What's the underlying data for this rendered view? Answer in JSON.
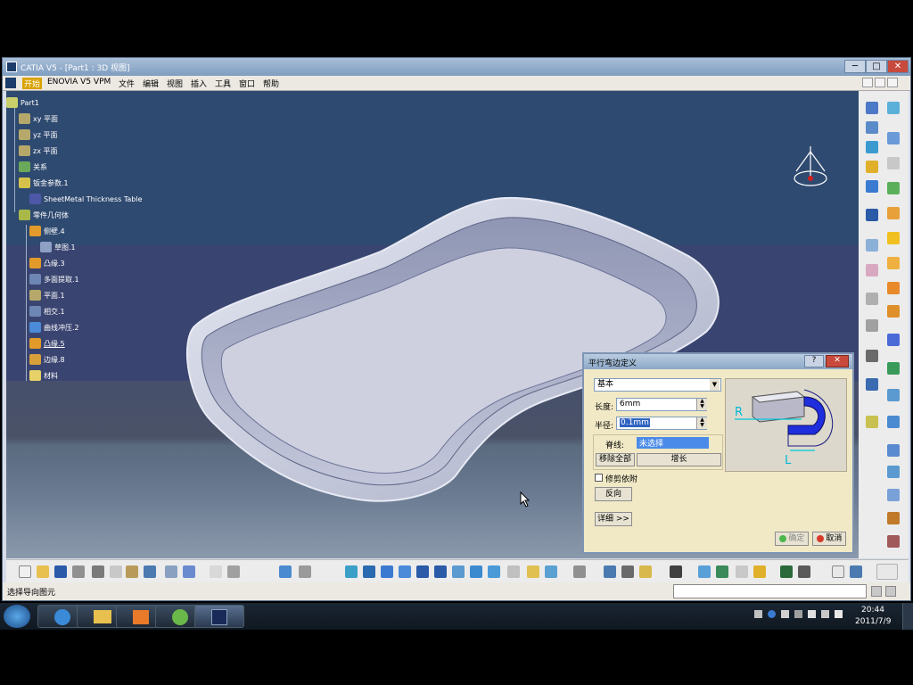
{
  "window": {
    "title": "CATIA V5 - [Part1 : 3D 视图]",
    "min_label": "─",
    "max_label": "□",
    "close_label": "✕"
  },
  "menu": [
    "开始",
    "ENOVIA V5 VPM",
    "文件",
    "编辑",
    "视图",
    "插入",
    "工具",
    "窗口",
    "帮助"
  ],
  "tree": {
    "root": "Part1",
    "nodes": [
      {
        "label": "xy 平面"
      },
      {
        "label": "yz 平面"
      },
      {
        "label": "zx 平面"
      },
      {
        "label": "关系"
      },
      {
        "label": "钣金参数.1"
      },
      {
        "label": "SheetMetal Thickness Table"
      },
      {
        "label": "零件几何体"
      },
      {
        "label": "侧壁.4"
      },
      {
        "label": "草图.1"
      },
      {
        "label": "凸缘.3"
      },
      {
        "label": "多面提取.1"
      },
      {
        "label": "平面.1"
      },
      {
        "label": "相交.1"
      },
      {
        "label": "曲线冲压.2"
      },
      {
        "label": "凸缘.5"
      },
      {
        "label": "边缘.8"
      },
      {
        "label": "材料"
      }
    ]
  },
  "dialog": {
    "title": "平行弯边定义",
    "help_label": "?",
    "close_label": "✕",
    "mode_value": "基本",
    "length_label": "长度:",
    "length_value": "6mm",
    "radius_label": "半径:",
    "radius_value": "0.1mm",
    "spine_label": "脊线:",
    "spine_value": "未选择",
    "remove_all_label": "移除全部",
    "extend_label": "增长",
    "trim_support_label": "修剪依附",
    "reverse_label": "反向",
    "more_label": "详细 >>",
    "ok_label": "确定",
    "cancel_label": "取消",
    "preview_label_r": "R",
    "preview_label_l": "L"
  },
  "status": {
    "prompt": "选择导向图元"
  },
  "taskbar": {
    "time": "20:44",
    "date": "2011/7/9"
  }
}
